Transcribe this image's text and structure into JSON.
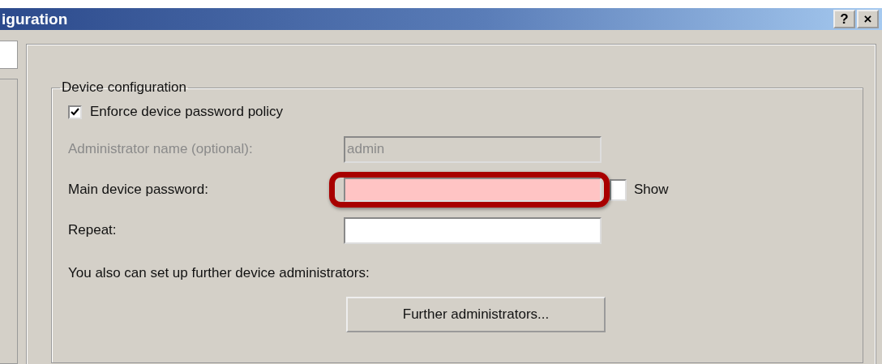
{
  "window": {
    "title": "iguration",
    "help_button": "?",
    "close_button": "×"
  },
  "sidebar": {
    "items": [
      {
        "selected": false
      },
      {
        "selected": true
      }
    ]
  },
  "group": {
    "title": "Device configuration",
    "enforce_policy": {
      "label": "Enforce device password policy",
      "checked": true
    },
    "fields": [
      {
        "label": "Administrator name (optional):",
        "value": "admin",
        "disabled": true,
        "highlighted": false
      },
      {
        "label": "Main device password:",
        "disabled": false,
        "highlighted": true,
        "show": {
          "label": "Show",
          "checked": false
        }
      },
      {
        "label": "Repeat:",
        "disabled": false,
        "highlighted": false
      }
    ],
    "note": "You also can set up further device administrators:",
    "button": "Further administrators..."
  }
}
